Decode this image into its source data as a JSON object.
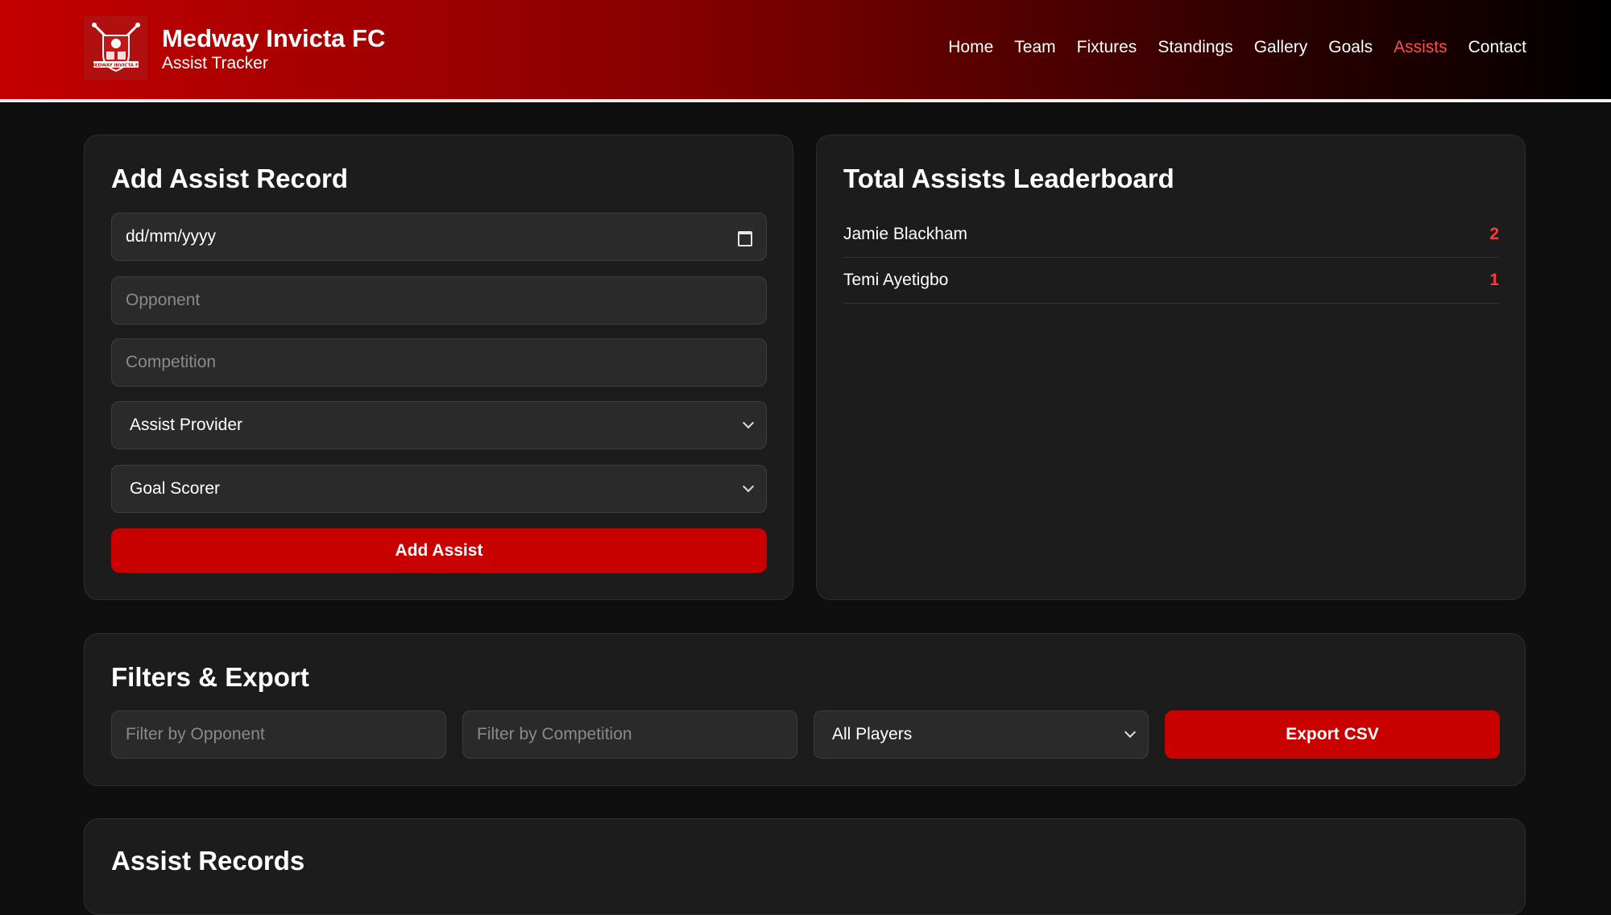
{
  "brand": {
    "title": "Medway Invicta FC",
    "subtitle": "Assist Tracker",
    "logo_icon": "club-crest-icon"
  },
  "nav": {
    "items": [
      {
        "label": "Home",
        "active": false
      },
      {
        "label": "Team",
        "active": false
      },
      {
        "label": "Fixtures",
        "active": false
      },
      {
        "label": "Standings",
        "active": false
      },
      {
        "label": "Gallery",
        "active": false
      },
      {
        "label": "Goals",
        "active": false
      },
      {
        "label": "Assists",
        "active": true
      },
      {
        "label": "Contact",
        "active": false
      }
    ]
  },
  "add_form": {
    "title": "Add Assist Record",
    "date_placeholder": "dd/mm/yyyy",
    "opponent_placeholder": "Opponent",
    "competition_placeholder": "Competition",
    "assist_provider_selected": "Assist Provider",
    "goal_scorer_selected": "Goal Scorer",
    "submit_label": "Add Assist"
  },
  "leaderboard": {
    "title": "Total Assists Leaderboard",
    "rows": [
      {
        "name": "Jamie Blackham",
        "count": "2"
      },
      {
        "name": "Temi Ayetigbo",
        "count": "1"
      }
    ]
  },
  "filters": {
    "title": "Filters & Export",
    "opponent_placeholder": "Filter by Opponent",
    "competition_placeholder": "Filter by Competition",
    "players_selected": "All Players",
    "export_label": "Export CSV"
  },
  "records": {
    "title": "Assist Records"
  },
  "colors": {
    "accent": "#c80000",
    "active_nav": "#ff4d4d",
    "count": "#ff3b3b",
    "card_bg": "#1c1c1c",
    "page_bg": "#0f0f0f"
  }
}
